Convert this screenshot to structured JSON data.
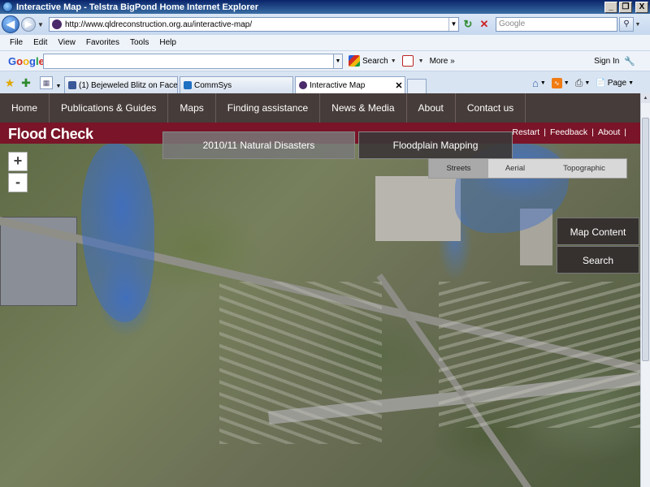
{
  "window": {
    "title": "Interactive Map - Telstra BigPond Home Internet Explorer",
    "minimize": "_",
    "restore": "❐",
    "close": "X"
  },
  "address": {
    "url": "http://www.qldreconstruction.org.au/interactive-map/",
    "search_placeholder": "Google"
  },
  "menu": [
    "File",
    "Edit",
    "View",
    "Favorites",
    "Tools",
    "Help"
  ],
  "google_toolbar": {
    "logo": [
      "G",
      "o",
      "o",
      "g",
      "l",
      "e"
    ],
    "search_label": "Search",
    "more_label": "More »",
    "sign_in": "Sign In"
  },
  "tabs": [
    {
      "label": "(1) Bejeweled Blitz on Facebo...",
      "color": "#3b5998"
    },
    {
      "label": "CommSys",
      "color": "#1f6fc2"
    },
    {
      "label": "Interactive Map",
      "color": "#4b2a6b"
    }
  ],
  "tab_tools": {
    "page_label": "Page"
  },
  "site_nav": [
    "Home",
    "Publications & Guides",
    "Maps",
    "Finding assistance",
    "News & Media",
    "About",
    "Contact us"
  ],
  "flood": {
    "title": "Flood Check",
    "links": [
      "Restart",
      "Feedback",
      "About"
    ]
  },
  "map": {
    "zoom_in": "+",
    "zoom_out": "-",
    "btn_disasters": "2010/11 Natural Disasters",
    "btn_floodplain": "Floodplain Mapping",
    "layers": [
      "Streets",
      "Aerial",
      "Topographic"
    ],
    "active_layer": "Streets",
    "map_content": "Map Content",
    "search": "Search"
  },
  "colors": {
    "site_nav_bg": "#463c39",
    "flood_bar": "#7a1428",
    "flood_water": "#3c6ec8"
  }
}
